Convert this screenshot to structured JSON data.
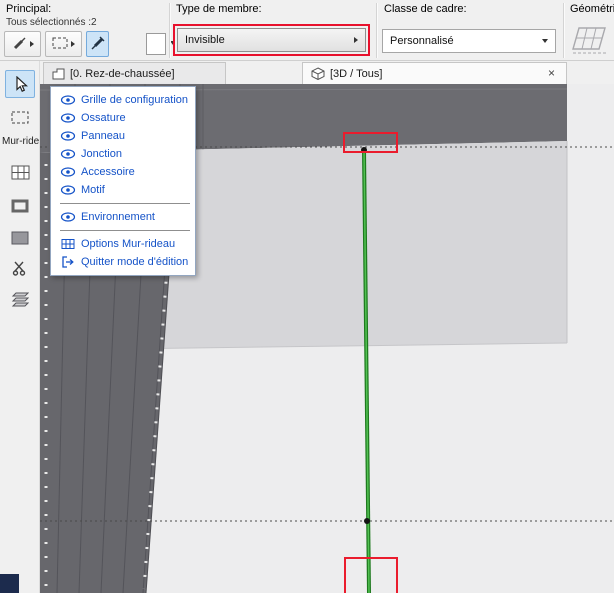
{
  "toolbar": {
    "principal": {
      "label": "Principal:",
      "selection_status": "Tous sélectionnés :2"
    },
    "member_type": {
      "label": "Type de membre:",
      "value": "Invisible"
    },
    "frame_class": {
      "label": "Classe de cadre:",
      "value": "Personnalisé"
    },
    "geometry": {
      "label": "Géométrie d"
    }
  },
  "tab_bar": {
    "plan_tab": "[0. Rez-de-chaussée]",
    "view_tab": "[3D / Tous]",
    "close_glyph": "×"
  },
  "sidebar": {
    "group_label": "Mur-ride"
  },
  "popup": {
    "items": [
      "Grille de configuration",
      "Ossature",
      "Panneau",
      "Jonction",
      "Accessoire",
      "Motif"
    ],
    "environment": "Environnement",
    "options_label": "Options Mur-rideau",
    "quit_label": "Quitter mode d'édition"
  },
  "colors": {
    "highlight_red": "#e8112d",
    "member_green": "#2f9e2f",
    "link_blue": "#1553c8",
    "selected_tool_blue": "#cde4f7"
  }
}
